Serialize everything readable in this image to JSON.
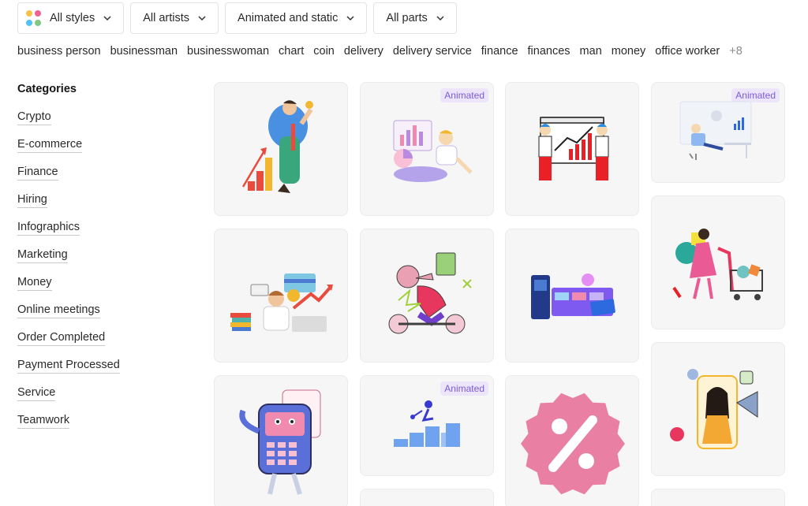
{
  "filters": {
    "styles": "All styles",
    "artists": "All artists",
    "animation": "Animated and static",
    "parts": "All parts",
    "style_dot_colors": [
      "#f6c445",
      "#f06292",
      "#4fc3f7",
      "#81c784"
    ]
  },
  "tags": [
    "business person",
    "businessman",
    "businesswoman",
    "chart",
    "coin",
    "delivery",
    "delivery service",
    "finance",
    "finances",
    "man",
    "money",
    "office worker"
  ],
  "tags_more": "+8",
  "sidebar": {
    "title": "Categories",
    "items": [
      "Crypto",
      "E-commerce",
      "Finance",
      "Hiring",
      "Infographics",
      "Marketing",
      "Money",
      "Online meetings",
      "Order Completed",
      "Payment Processed",
      "Service",
      "Teamwork"
    ]
  },
  "gallery": {
    "badge_label": "Animated",
    "cards": [
      {
        "illustration": "businessman-with-growth-chart",
        "animated": false
      },
      {
        "illustration": "person-with-charts",
        "animated": true
      },
      {
        "illustration": "presentation-board",
        "animated": false
      },
      {
        "illustration": "office-worker-dashboard",
        "animated": true
      },
      {
        "illustration": "woman-shopping-cart",
        "animated": false
      },
      {
        "illustration": "man-with-books-and-card",
        "animated": false
      },
      {
        "illustration": "courier-on-scooter",
        "animated": false
      },
      {
        "illustration": "payment-cards",
        "animated": false
      },
      {
        "illustration": "woman-with-megaphone",
        "animated": false
      },
      {
        "illustration": "payment-terminal-character",
        "animated": false
      },
      {
        "illustration": "climbing-stairs-chart",
        "animated": true
      },
      {
        "illustration": "percent-discount-badge",
        "animated": false
      }
    ]
  },
  "colors": {
    "accent_purple": "#7c5bd6",
    "badge_bg": "#ede6fb",
    "card_bg": "#f6f6f7"
  }
}
